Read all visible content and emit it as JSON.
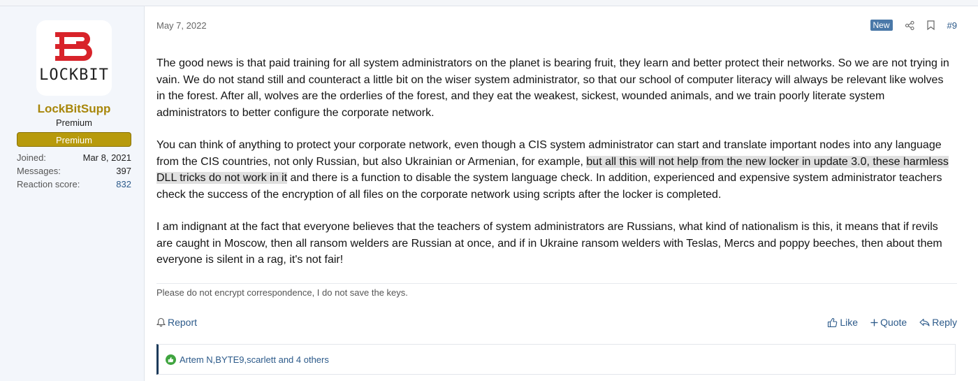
{
  "user": {
    "avatar_text": "LOCKBIT",
    "username": "LockBitSupp",
    "title": "Premium",
    "banner": "Premium",
    "stats": [
      {
        "label": "Joined:",
        "value": "Mar 8, 2021"
      },
      {
        "label": "Messages:",
        "value": "397"
      },
      {
        "label": "Reaction score:",
        "value": "832"
      }
    ]
  },
  "post": {
    "date": "May 7, 2022",
    "badge": "New",
    "number": "#9",
    "paragraphs": {
      "p1": "The good news is that paid training for all system administrators on the planet is bearing fruit, they learn and better protect their networks. So we are not trying in vain. We do not stand still and counteract a little bit on the wiser system administrator, so that our school of computer literacy will always be relevant like wolves in the forest. After all, wolves are the orderlies of the forest, and they eat the weakest, sickest, wounded animals, and we train poorly literate system administrators to better configure the corporate network.",
      "p2_before": "You can think of anything to protect your corporate network, even though a CIS system administrator can start and translate important nodes into any language from the CIS countries, not only Russian, but also Ukrainian or Armenian, for example, ",
      "p2_highlight": "but all this will not help from the new locker in update 3.0, these harmless DLL tricks do not work in it",
      "p2_after": " and there is a function to disable the system language check. In addition, experienced and expensive system administrator teachers check the success of the encryption of all files on the corporate network using scripts after the locker is completed.",
      "p3": "I am indignant at the fact that everyone believes that the teachers of system administrators are Russians, what kind of nationalism is this, it means that if revils are caught in Moscow, then all ransom welders are Russian at once, and if in Ukraine ransom welders with Teslas, Mercs and poppy beeches, then about them everyone is silent in a rag, it's not fair!"
    },
    "signature": "Please do not encrypt correspondence, I do not save the keys.",
    "actions": {
      "report": "Report",
      "like": "Like",
      "quote": "Quote",
      "reply": "Reply"
    },
    "reactions": "Artem N,BYTE9,scarlett and 4 others"
  },
  "colors": {
    "username": "#a8860a",
    "banner": "#b79a0c",
    "link": "#2c5a8a",
    "badge_new": "#4a78a8",
    "logo_red": "#d8232a"
  },
  "icons": [
    "share-icon",
    "bookmark-icon",
    "bell-icon",
    "thumbs-up-icon",
    "plus-icon",
    "reply-icon",
    "like-reaction-icon"
  ]
}
